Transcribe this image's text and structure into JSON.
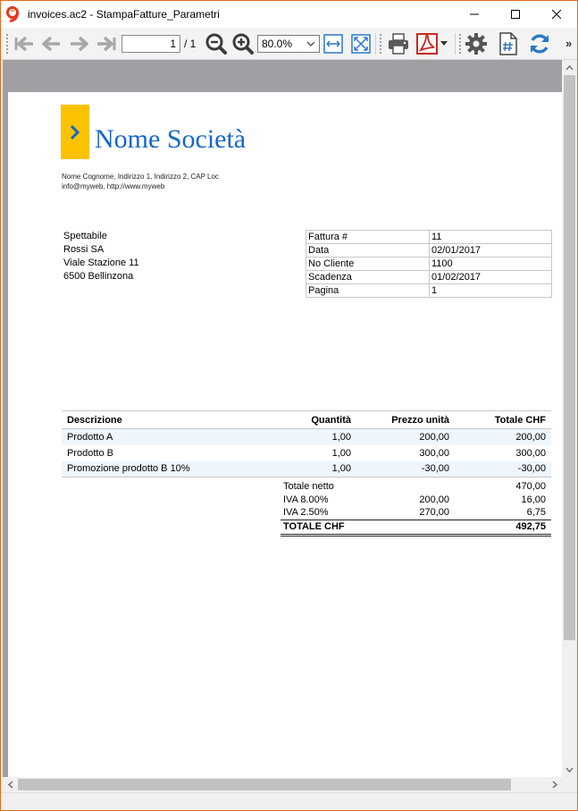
{
  "window": {
    "title": "invoices.ac2 - StampaFatture_Parametri"
  },
  "toolbar": {
    "page_current": "1",
    "page_total": "/ 1",
    "zoom": "80.0%",
    "icons": [
      "first-page-icon",
      "previous-page-icon",
      "next-page-icon",
      "last-page-icon",
      "zoom-out-icon",
      "zoom-in-icon",
      "fit-width-icon",
      "fit-page-icon",
      "print-icon",
      "pdf-icon",
      "settings-icon",
      "page-number-icon",
      "refresh-icon"
    ]
  },
  "invoice": {
    "company_name": "Nome Società",
    "company_line1": "Nome Cognome, Indirizzo 1, Indirizzo 2, CAP Loc",
    "company_line2": "info@myweb, http://www.myweb",
    "address": [
      "Spettabile",
      "Rossi SA",
      "Viale Stazione 11",
      "6500 Bellinzona"
    ],
    "info": [
      {
        "label": "Fattura #",
        "value": "11"
      },
      {
        "label": "Data",
        "value": "02/01/2017"
      },
      {
        "label": "No Cliente",
        "value": "1100"
      },
      {
        "label": "Scadenza",
        "value": "01/02/2017"
      },
      {
        "label": "Pagina",
        "value": "1"
      }
    ],
    "columns": [
      "Descrizione",
      "Quantità",
      "Prezzo unità",
      "Totale CHF"
    ],
    "items": [
      {
        "description": "Prodotto A",
        "quantity": "1,00",
        "price": "200,00",
        "total": "200,00"
      },
      {
        "description": "Prodotto B",
        "quantity": "1,00",
        "price": "300,00",
        "total": "300,00"
      },
      {
        "description": "Promozione prodotto B 10%",
        "quantity": "1,00",
        "price": "-30,00",
        "total": "-30,00"
      }
    ],
    "totals": [
      {
        "label": "Totale netto",
        "base": "",
        "amount": "470,00"
      },
      {
        "label": "IVA 8.00%",
        "base": "200,00",
        "amount": "16,00"
      },
      {
        "label": "IVA 2.50%",
        "base": "270,00",
        "amount": "6,75"
      }
    ],
    "grand_total": {
      "label": "TOTALE CHF",
      "amount": "492,75"
    }
  },
  "colors": {
    "brand_blue": "#1466c8",
    "logo_yellow": "#fcc200",
    "row_shade": "#eef5fc",
    "window_border": "#e06a1a"
  }
}
